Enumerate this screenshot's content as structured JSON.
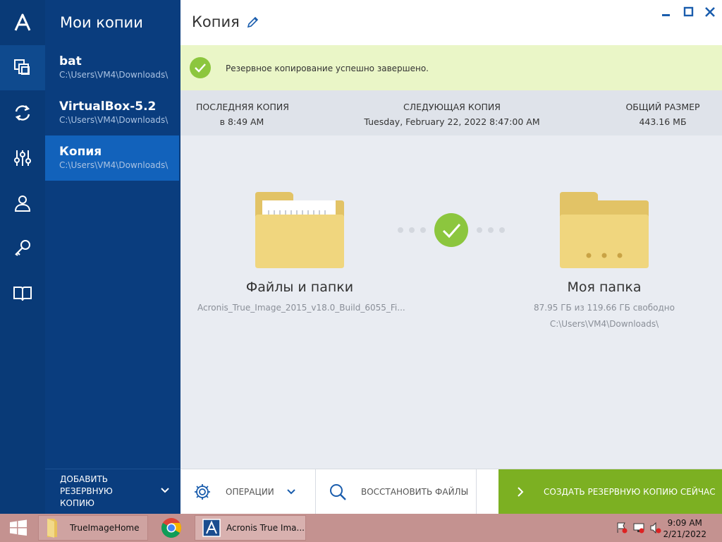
{
  "app": {
    "logo_letter": "A"
  },
  "sidebar": {
    "title": "Мои копии",
    "backups": [
      {
        "name": "bat",
        "path": "C:\\Users\\VM4\\Downloads\\"
      },
      {
        "name": "VirtualBox-5.2",
        "path": "C:\\Users\\VM4\\Downloads\\"
      },
      {
        "name": "Копия",
        "path": "C:\\Users\\VM4\\Downloads\\"
      }
    ],
    "add_backup_label": "ДОБАВИТЬ РЕЗЕРВНУЮ КОПИЮ"
  },
  "header": {
    "title": "Копия"
  },
  "banner": {
    "message": "Резервное копирование успешно завершено."
  },
  "stats": {
    "last_label": "Последняя копия",
    "last_value": "в 8:49 AM",
    "next_label": "Следующая копия",
    "next_value": "Tuesday, February 22, 2022 8:47:00 AM",
    "size_label": "Общий размер",
    "size_value": "443.16 МБ"
  },
  "source": {
    "title": "Файлы и папки",
    "subtitle": "Acronis_True_Image_2015_v18.0_Build_6055_Fi..."
  },
  "destination": {
    "title": "Моя папка",
    "space": "87.95 ГБ из 119.66 ГБ свободно",
    "path": "C:\\Users\\VM4\\Downloads\\"
  },
  "toolbar": {
    "operations_label": "Операции",
    "restore_label": "Восстановить файлы",
    "backup_now_label": "Создать резервную копию сейчас"
  },
  "taskbar": {
    "items": [
      {
        "label": "TrueImageHome"
      },
      {
        "label": "Acronis True Ima..."
      }
    ],
    "time": "9:09 AM",
    "date": "2/21/2022"
  },
  "colors": {
    "rail": "#093a77",
    "panel": "#0a3d7e",
    "selected": "#1262bb",
    "accent_green": "#7cb022",
    "banner_bg": "#eaf6c7",
    "taskbar": "#c49290"
  }
}
